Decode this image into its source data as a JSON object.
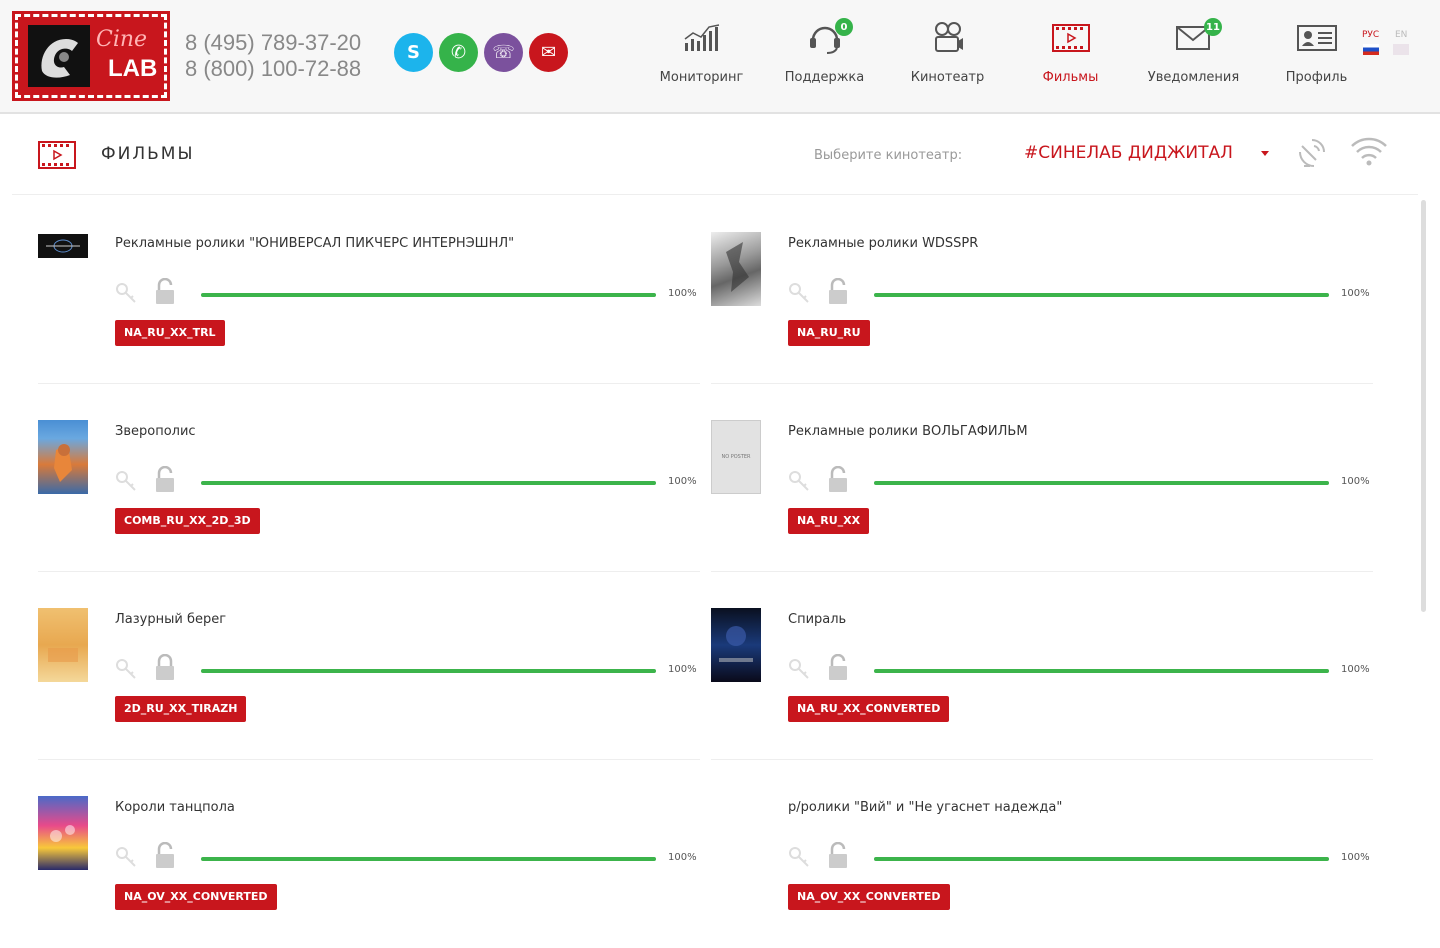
{
  "logo": {
    "cine": "Cine",
    "lab": "LAB"
  },
  "phones": [
    "8 (495) 789-37-20",
    "8 (800) 100-72-88"
  ],
  "contacts": [
    {
      "name": "skype",
      "glyph": "S"
    },
    {
      "name": "whatsapp",
      "glyph": "✆"
    },
    {
      "name": "viber",
      "glyph": "☏"
    },
    {
      "name": "mail",
      "glyph": "✉"
    }
  ],
  "nav": [
    {
      "label": "Мониторинг",
      "icon": "monitoring-icon"
    },
    {
      "label": "Поддержка",
      "icon": "support-icon",
      "badge": "0"
    },
    {
      "label": "Кинотеатр",
      "icon": "projector-icon"
    },
    {
      "label": "Фильмы",
      "icon": "film-icon"
    },
    {
      "label": "Уведомления",
      "icon": "mail-icon",
      "badge": "11"
    },
    {
      "label": "Профиль",
      "icon": "profile-icon"
    }
  ],
  "lang": [
    {
      "label": "РУС"
    },
    {
      "label": "EN"
    }
  ],
  "page": {
    "title": "ФИЛЬМЫ",
    "select_label": "Выберите кинотеатр:",
    "select_value": "#СИНЕЛАБ ДИДЖИТАЛ"
  },
  "films": [
    {
      "title": "Рекламные ролики \"ЮНИВЕРСАЛ ПИКЧЕРС ИНТЕРНЭШНЛ\"",
      "progress_pct": "100%",
      "progress": 1.0,
      "tag": "NA_RU_XX_TRL",
      "poster": "universal"
    },
    {
      "title": "Рекламные ролики WDSSPR",
      "progress_pct": "100%",
      "progress": 1.0,
      "tag": "NA_RU_RU",
      "poster": "wdsspr"
    },
    {
      "title": "Зверополис",
      "progress_pct": "100%",
      "progress": 1.0,
      "tag": "COMB_RU_XX_2D_3D",
      "poster": "zootopia"
    },
    {
      "title": "Рекламные ролики ВОЛЬГАФИЛЬМ",
      "progress_pct": "100%",
      "progress": 1.0,
      "tag": "NA_RU_XX",
      "poster": "noposter",
      "poster_text": "NO POSTER"
    },
    {
      "title": "Лазурный берег",
      "progress_pct": "100%",
      "progress": 1.0,
      "tag": "2D_RU_XX_TIRAZH",
      "poster": "azure"
    },
    {
      "title": "Спираль",
      "progress_pct": "100%",
      "progress": 1.0,
      "tag": "NA_RU_XX_CONVERTED",
      "poster": "spiral"
    },
    {
      "title": "Короли танцпола",
      "progress_pct": "100%",
      "progress": 1.0,
      "tag": "NA_OV_XX_CONVERTED",
      "poster": "dance"
    },
    {
      "title": "р/ролики \"Вий\" и \"Не угаснет надежда\"",
      "progress_pct": "100%",
      "progress": 1.0,
      "tag": "NA_OV_XX_CONVERTED",
      "poster": "none"
    }
  ],
  "colors": {
    "accent": "#c8161d",
    "progress": "#3cb44b"
  }
}
